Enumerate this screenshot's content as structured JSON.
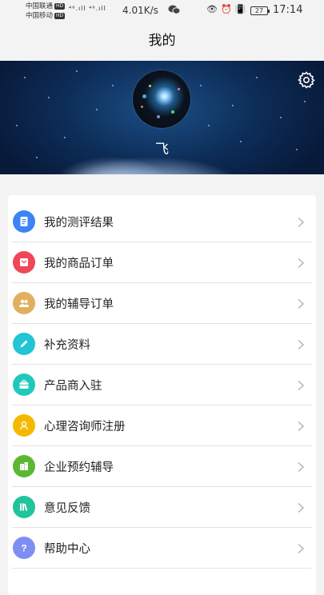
{
  "status_bar": {
    "carrier1": "中国联通",
    "carrier2": "中国移动",
    "hd_badge": "HD",
    "signal_text": "⁴⁶.ıll ⁴⁶.ıll",
    "net_speed": "4.01K/s",
    "battery": "27",
    "time": "17:14",
    "icons": [
      "wechat-icon",
      "eye-icon",
      "alarm-icon",
      "vibrate-icon"
    ]
  },
  "header": {
    "title": "我的"
  },
  "profile": {
    "username": "飞"
  },
  "menu": [
    {
      "label": "我的测评结果",
      "icon": "document-icon",
      "color": "#3c84f3"
    },
    {
      "label": "我的商品订单",
      "icon": "envelope-icon",
      "color": "#f0465a"
    },
    {
      "label": "我的辅导订单",
      "icon": "people-icon",
      "color": "#e0b060"
    },
    {
      "label": "补充资料",
      "icon": "pencil-icon",
      "color": "#20c5d6"
    },
    {
      "label": "产品商入驻",
      "icon": "briefcase-icon",
      "color": "#1fc9bc"
    },
    {
      "label": "心理咨询师注册",
      "icon": "person-icon",
      "color": "#f5b800"
    },
    {
      "label": "企业预约辅导",
      "icon": "building-icon",
      "color": "#5cb833"
    },
    {
      "label": "意见反馈",
      "icon": "books-icon",
      "color": "#20c49a"
    },
    {
      "label": "帮助中心",
      "icon": "question-icon",
      "color": "#7d8ff2"
    }
  ]
}
